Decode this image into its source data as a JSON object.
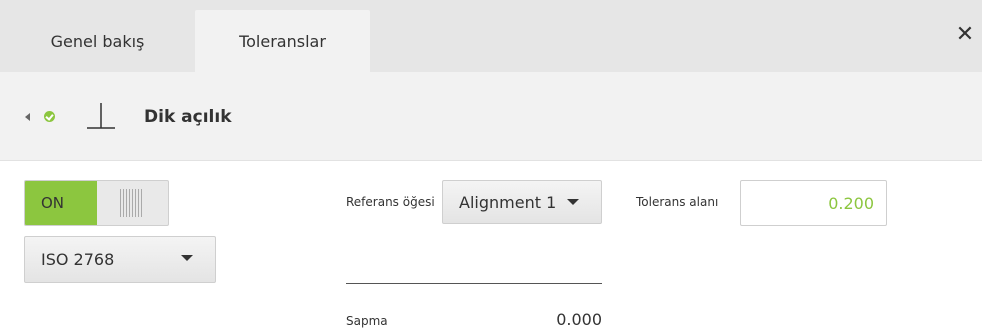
{
  "tabs": [
    {
      "label": "Genel bakış"
    },
    {
      "label": "Toleranslar"
    }
  ],
  "close_icon": "close-icon",
  "header": {
    "feature_name": "Dik açılık",
    "icons": [
      "back-arrow-icon",
      "check-circle-icon",
      "perpendicularity-icon"
    ]
  },
  "toggle": {
    "on_label": "ON",
    "state": "on"
  },
  "standard": {
    "value": "ISO 2768"
  },
  "reference": {
    "label": "Referans öğesi",
    "value": "Alignment 1"
  },
  "tolerance": {
    "label": "Tolerans alanı",
    "value": "0.200"
  },
  "deviation": {
    "label": "Sapma",
    "value": "0.000"
  },
  "colors": {
    "accent": "#8cc63f",
    "tabbar": "#e6e6e6",
    "panel": "#f2f2f2"
  }
}
